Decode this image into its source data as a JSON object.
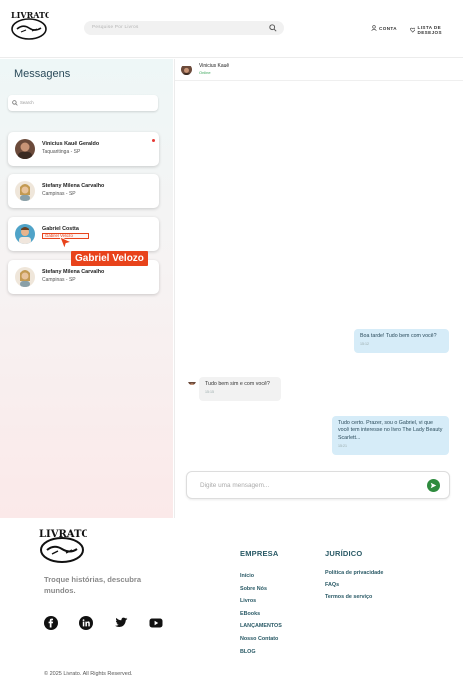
{
  "header": {
    "logo_text": "LIVRATO",
    "search_placeholder": "Pesquise Por Livros",
    "account_label": "CONTA",
    "wishlist_label": "LISTA DE DESEJOS"
  },
  "sidebar": {
    "title": "Messagens",
    "search_placeholder": "Search",
    "contacts": [
      {
        "name": "Vinicius Kauê Geraldo",
        "location": "Taquaritinga - SP",
        "unread": true
      },
      {
        "name": "Stefany Milena Carvalho",
        "location": "Campinas - SP",
        "unread": false
      },
      {
        "name": "Gabriel Costta",
        "location": "Gabriel Velozo",
        "unread": false
      },
      {
        "name": "Stefany Milena Carvalho",
        "location": "Campinas - SP",
        "unread": false
      }
    ],
    "tooltip": "Gabriel Velozo"
  },
  "chat": {
    "contact_name": "Vinicius Kauê",
    "contact_status": "Online",
    "messages": [
      {
        "direction": "out",
        "text": "Boa tarde! Tudo bem com você?",
        "time": "15:12"
      },
      {
        "direction": "in",
        "text": "Tudo bem sim e com você?",
        "time": "15:15"
      },
      {
        "direction": "out",
        "text": "Tudo certo. Prazer, sou o Gabriel, vi que você tem interesse no livro The Lady Beauty Scarlett...",
        "time": "15:21"
      }
    ],
    "composer_placeholder": "Digite uma mensagem..."
  },
  "footer": {
    "logo_text": "LIVRATO",
    "tagline": "Troque histórias, descubra mundos.",
    "socials": [
      "facebook-icon",
      "linkedin-icon",
      "twitter-icon",
      "youtube-icon"
    ],
    "company_heading": "EMPRESA",
    "company_links": [
      "Início",
      "Sobre Nós",
      "Livros",
      "EBooks",
      "LANÇAMENTOS",
      "Nosso Contato",
      "BLOG"
    ],
    "legal_heading": "JURÍDICO",
    "legal_links": [
      "Política de privacidade",
      "FAQs",
      "Termos de serviço"
    ],
    "copyright": "© 2025 Livrato. All Rights Reserved."
  },
  "colors": {
    "accent_red": "#e8431b",
    "send_green": "#2e8b3e",
    "bubble_out": "#d6ecf8",
    "footer_text": "#2a5a66"
  }
}
